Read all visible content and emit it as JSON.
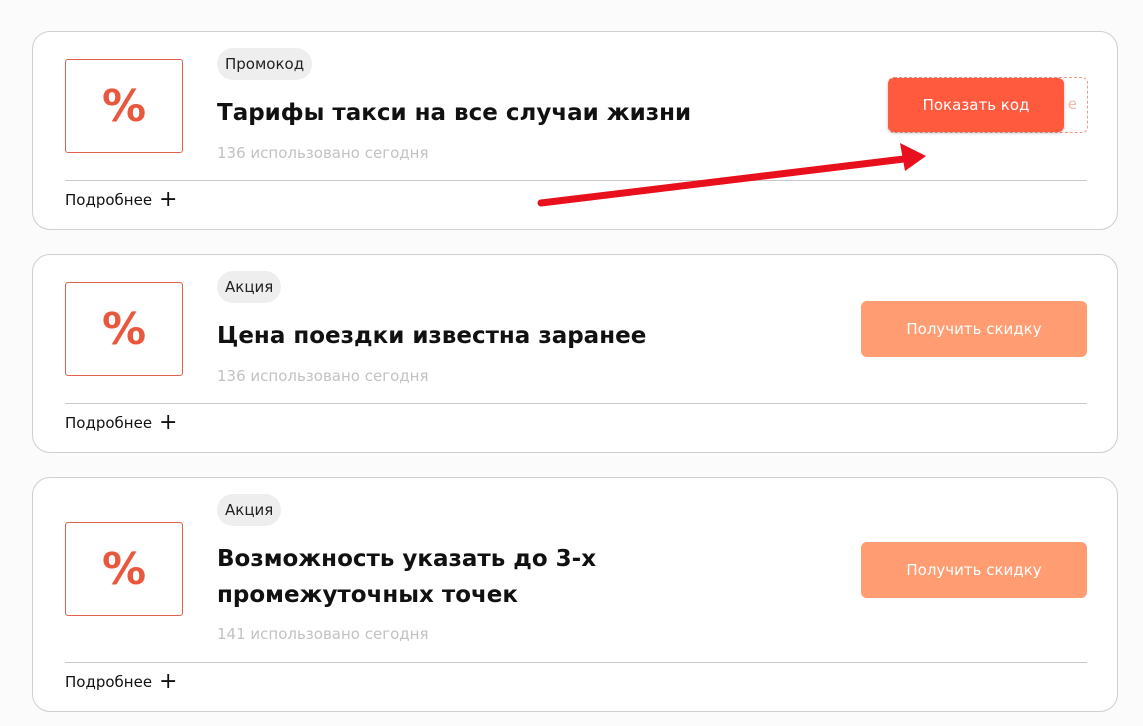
{
  "offers": [
    {
      "badge": "Промокод",
      "title": "Тарифы такси на все случаи жизни",
      "usage": "136 использовано сегодня",
      "more_label": "Подробнее",
      "button_label": "Показать код",
      "code_peek": "е",
      "icon": "percent-icon"
    },
    {
      "badge": "Акция",
      "title": "Цена поездки известна заранее",
      "usage": "136 использовано сегодня",
      "more_label": "Подробнее",
      "button_label": "Получить скидку",
      "icon": "percent-icon"
    },
    {
      "badge": "Акция",
      "title": "Возможность указать до 3-х промежуточных точек",
      "usage": "141 использовано сегодня",
      "more_label": "Подробнее",
      "button_label": "Получить скидку",
      "icon": "percent-icon"
    }
  ],
  "icon_symbol": "%",
  "colors": {
    "accent": "#ff5a3e",
    "discount_button": "#ff9c72",
    "icon_border": "#e2604d",
    "annotation_arrow": "#e8101c"
  }
}
